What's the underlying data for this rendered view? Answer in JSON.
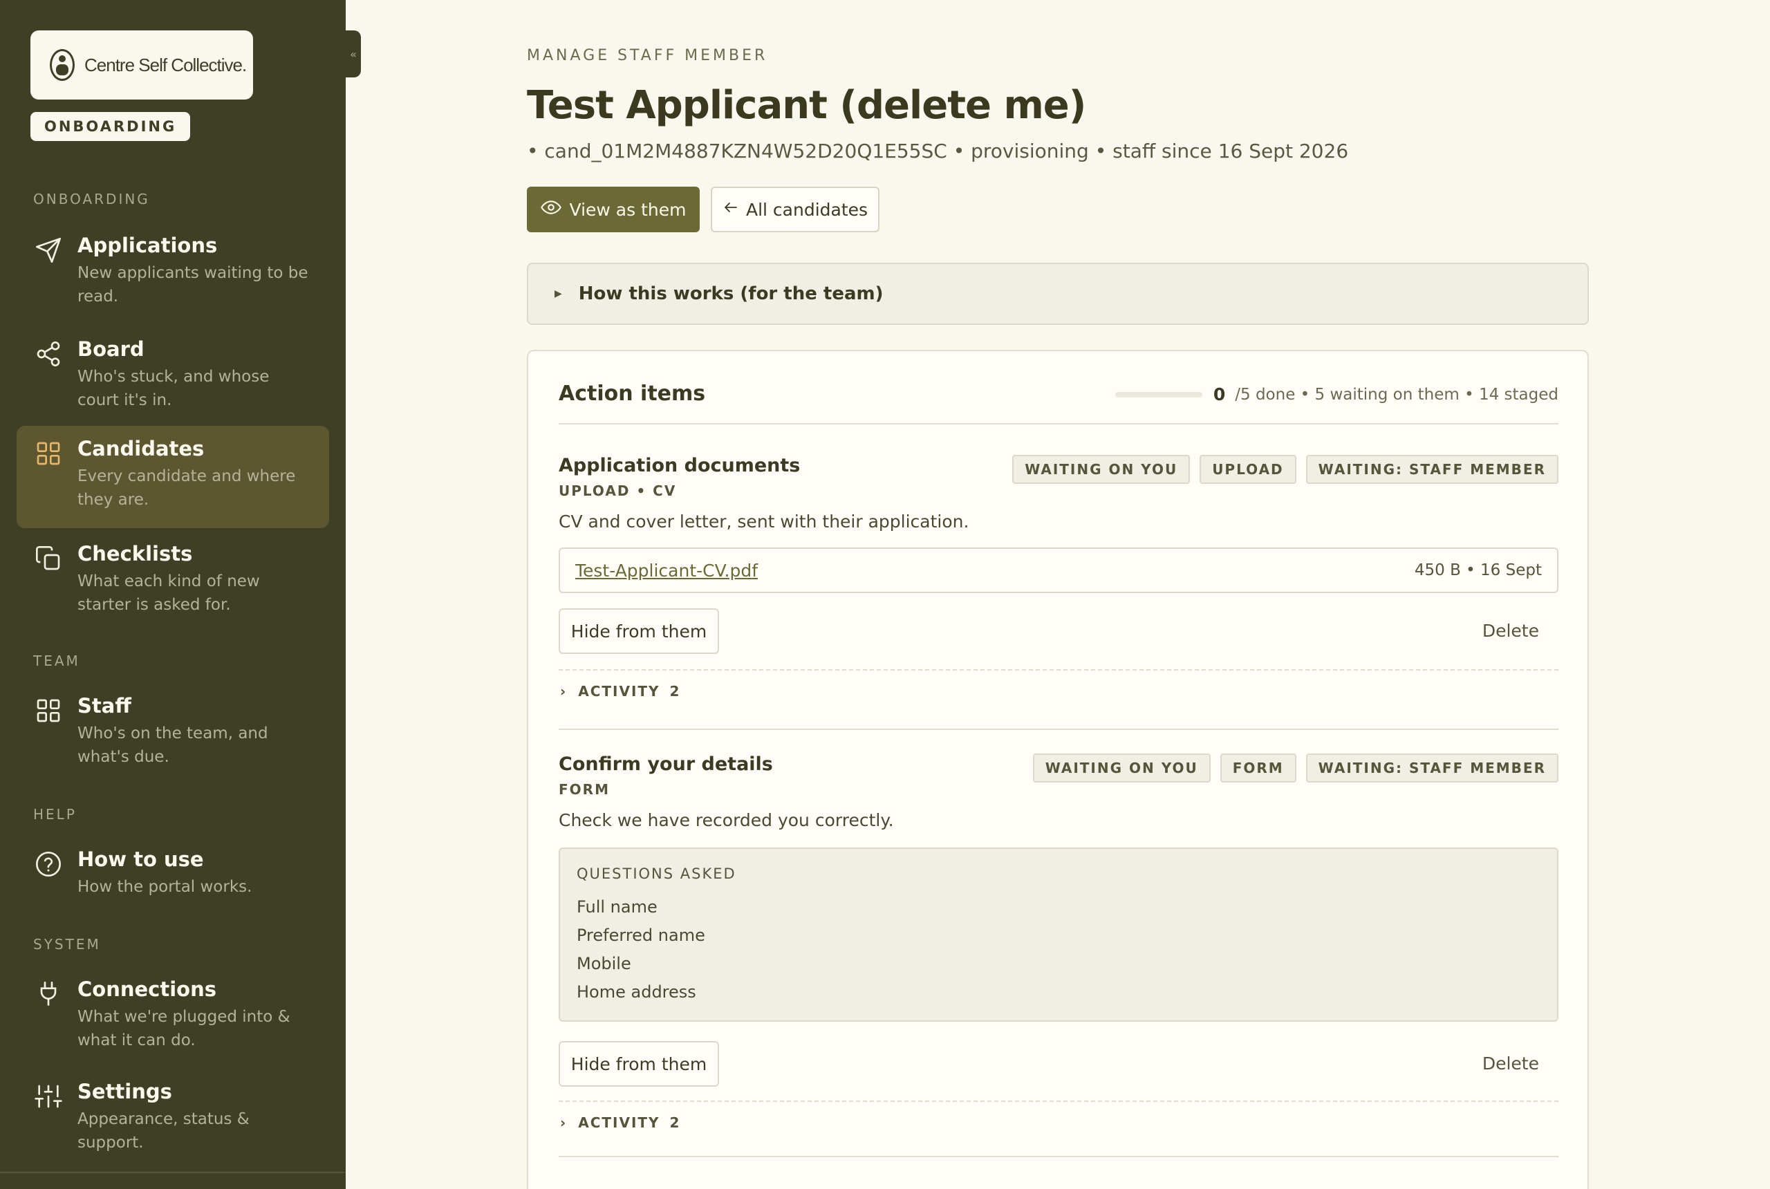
{
  "sidebar": {
    "logo_text": "Centre Self Collective.",
    "mode_badge": "ONBOARDING",
    "collapse_glyph": "«",
    "sections": {
      "onboarding": "ONBOARDING",
      "team": "TEAM",
      "help": "HELP",
      "system": "SYSTEM"
    },
    "items": [
      {
        "icon": "send-icon",
        "title": "Applications",
        "desc": "New applicants waiting to be read."
      },
      {
        "icon": "share-icon",
        "title": "Board",
        "desc": "Who's stuck, and whose court it's in."
      },
      {
        "icon": "grid-icon",
        "title": "Candidates",
        "desc": "Every candidate and where they are.",
        "active": true
      },
      {
        "icon": "copy-icon",
        "title": "Checklists",
        "desc": "What each kind of new starter is asked for."
      },
      {
        "icon": "grid-icon",
        "title": "Staff",
        "desc": "Who's on the team, and what's due."
      },
      {
        "icon": "help-circle-icon",
        "title": "How to use",
        "desc": "How the portal works."
      },
      {
        "icon": "plug-icon",
        "title": "Connections",
        "desc": "What we're plugged into & what it can do."
      },
      {
        "icon": "sliders-icon",
        "title": "Settings",
        "desc": "Appearance, status & support."
      }
    ]
  },
  "header": {
    "eyebrow": "MANAGE STAFF MEMBER",
    "title": "Test Applicant (delete me)",
    "meta": "• cand_01M2M4887KZN4W52D20Q1E55SC • provisioning • staff since 16 Sept 2026",
    "view_as_label": "View as them",
    "all_candidates_label": "All candidates"
  },
  "how_it_works": "How this works (for the team)",
  "action_items": {
    "title": "Action items",
    "done_count": "0",
    "progress_fraction": 0,
    "summary": "/5 done • 5 waiting on them • 14 staged",
    "items": [
      {
        "title": "Application documents",
        "sub": "UPLOAD • CV",
        "tags": [
          "WAITING ON YOU",
          "UPLOAD",
          "WAITING: STAFF MEMBER"
        ],
        "desc": "CV and cover letter, sent with their application.",
        "file_name": "Test-Applicant-CV.pdf",
        "file_meta": "450 B • 16 Sept",
        "hide_label": "Hide from them",
        "delete_label": "Delete",
        "activity_label": "ACTIVITY",
        "activity_count": "2"
      },
      {
        "title": "Confirm your details",
        "sub": "FORM",
        "tags": [
          "WAITING ON YOU",
          "FORM",
          "WAITING: STAFF MEMBER"
        ],
        "desc": "Check we have recorded you correctly.",
        "questions_label": "QUESTIONS ASKED",
        "questions": [
          "Full name",
          "Preferred name",
          "Mobile",
          "Home address"
        ],
        "hide_label": "Hide from them",
        "delete_label": "Delete",
        "activity_label": "ACTIVITY",
        "activity_count": "2"
      }
    ]
  },
  "colors": {
    "sidebar_bg": "#3e3f24",
    "page_bg": "#faf7ef",
    "accent": "#6b6a35",
    "active_icon": "#e9b66a"
  }
}
